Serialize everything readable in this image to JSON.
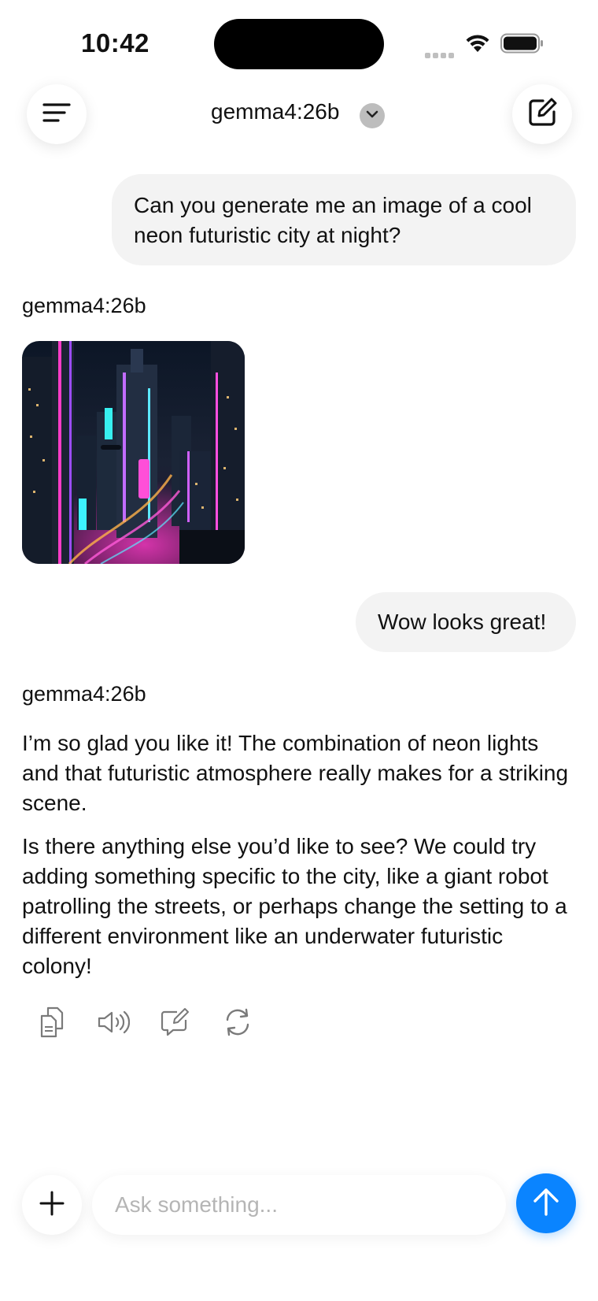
{
  "status_bar": {
    "time": "10:42"
  },
  "header": {
    "model_name": "gemma4:26b"
  },
  "conversation": {
    "messages": [
      {
        "role": "user",
        "text": "Can you generate me an image of a cool neon futuristic city at night?"
      },
      {
        "role": "assistant",
        "sender": "gemma4:26b",
        "content": "image"
      },
      {
        "role": "user",
        "text": "Wow looks great!"
      },
      {
        "role": "assistant",
        "sender": "gemma4:26b",
        "paragraphs": [
          "I’m so glad you like it! The combination of neon lights and that futuristic atmosphere really makes for a striking scene.",
          "Is there anything else you’d like to see? We could try adding something specific to the city, like a giant robot patrolling the streets, or perhaps change the setting to a different environment like an underwater futuristic colony!"
        ]
      }
    ],
    "actions": [
      "copy-icon",
      "speaker-icon",
      "edit-message-icon",
      "regenerate-icon"
    ]
  },
  "composer": {
    "placeholder": "Ask something..."
  },
  "colors": {
    "accent": "#0a84ff",
    "bubble": "#f3f3f3"
  }
}
